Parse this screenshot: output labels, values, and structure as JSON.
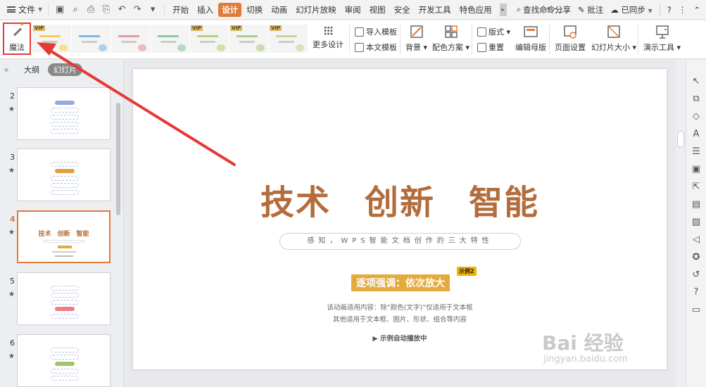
{
  "menubar": {
    "file_label": "文件",
    "tabs": [
      "开始",
      "插入",
      "设计",
      "切换",
      "动画",
      "幻灯片放映",
      "审阅",
      "视图",
      "安全",
      "开发工具",
      "特色应用"
    ],
    "active_tab": "设计",
    "search_label": "查找命令...",
    "share_label": "分享",
    "comment_label": "批注",
    "sync_label": "已同步",
    "help_label": "?"
  },
  "ribbon": {
    "magic_label": "魔法",
    "templates": [
      {
        "vip": "VIP",
        "accent": "#f4d24b"
      },
      {
        "vip": "",
        "accent": "#7fb7e6"
      },
      {
        "vip": "",
        "accent": "#e49a9a"
      },
      {
        "vip": "",
        "accent": "#8fc7a3"
      },
      {
        "vip": "VIP",
        "accent": "#b4d27a"
      },
      {
        "vip": "VIP",
        "accent": "#a7cf86"
      },
      {
        "vip": "VIP",
        "accent": "#cfd39a"
      }
    ],
    "more_design_label": "更多设计",
    "import_template_label": "导入模板",
    "this_template_label": "本文模板",
    "background_label": "背景",
    "color_scheme_label": "配色方案",
    "layout_label": "版式",
    "reset_label": "重置",
    "edit_master_label": "编辑母版",
    "page_setup_label": "页面设置",
    "slide_size_label": "幻灯片大小",
    "presentation_tools_label": "演示工具"
  },
  "left_panel": {
    "outline_tab": "大纲",
    "slides_tab": "幻灯片",
    "slides": [
      {
        "num": "2",
        "pill_color": "#9aa7e0"
      },
      {
        "num": "3",
        "pill_color": "#e0a23c"
      },
      {
        "num": "4",
        "active": true,
        "title": "技术　创新　智能"
      },
      {
        "num": "5",
        "pill_color": "#ee7d85"
      },
      {
        "num": "6",
        "pill_color": "#9ec46f"
      }
    ]
  },
  "slide": {
    "title_words": [
      "技术",
      "创新",
      "智能"
    ],
    "subtitle": "感知，WPS智能文档创作的三大特性",
    "emphasis": "逐项强调：依次放大",
    "badge": "示例2",
    "desc_line1": "该动画适用内容：除“颜色(文字)”仅适用于文本框",
    "desc_line2": "其他适用于文本框、图片、形状、组合等内容",
    "auto_play": "示例自动播放中"
  },
  "watermark": {
    "main": "Bai 经验",
    "sub": "jingyan.baidu.com"
  },
  "colors": {
    "accent": "#e07b39",
    "title": "#b36d3c",
    "highlight": "#e3ab3c",
    "annotation": "#e53935"
  }
}
